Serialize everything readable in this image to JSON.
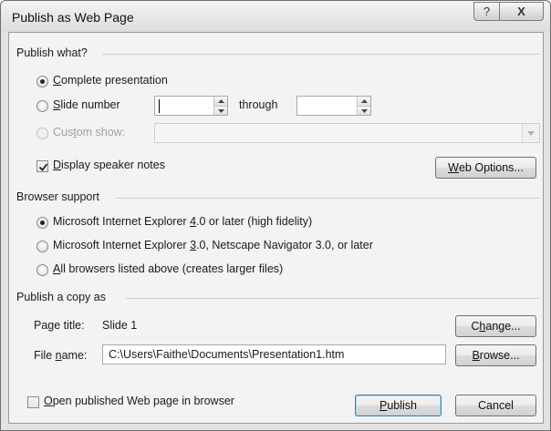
{
  "window": {
    "title": "Publish as Web Page",
    "help_label": "?",
    "close_label": "X"
  },
  "publish_what": {
    "heading": "Publish what?",
    "complete_presentation": {
      "pre": "",
      "mnemonic": "C",
      "post": "omplete presentation",
      "selected": true
    },
    "slide_number": {
      "pre": "",
      "mnemonic": "S",
      "post": "lide number",
      "selected": false,
      "from_value": "",
      "to_value": ""
    },
    "through": {
      "pre": "throu",
      "mnemonic": "g",
      "post": "h"
    },
    "custom_show": {
      "pre": "Cus",
      "mnemonic": "t",
      "post": "om show:",
      "selected": false,
      "enabled": false,
      "value": ""
    },
    "speaker_notes": {
      "pre": "",
      "mnemonic": "D",
      "post": "isplay speaker notes",
      "checked": true
    },
    "web_options": {
      "pre": "",
      "mnemonic": "W",
      "post": "eb Options..."
    }
  },
  "browser_support": {
    "heading": "Browser support",
    "ie4": {
      "pre": "Microsoft Internet Explorer ",
      "mnemonic": "4",
      "post": ".0 or later (high fidelity)",
      "selected": true
    },
    "ie3": {
      "pre": "Microsoft Internet Explorer ",
      "mnemonic": "3",
      "post": ".0, Netscape Navigator 3.0, or later",
      "selected": false
    },
    "all": {
      "pre": "",
      "mnemonic": "A",
      "post": "ll browsers listed above (creates larger files)",
      "selected": false
    }
  },
  "publish_copy": {
    "heading": "Publish a copy as",
    "page_title_label": "Page title:",
    "page_title_value": "Slide 1",
    "change": {
      "pre": "C",
      "mnemonic": "h",
      "post": "ange..."
    },
    "file_name": {
      "pre": "File ",
      "mnemonic": "n",
      "post": "ame:"
    },
    "file_name_value": "C:\\Users\\Faithe\\Documents\\Presentation1.htm",
    "browse": {
      "pre": "",
      "mnemonic": "B",
      "post": "rowse..."
    }
  },
  "footer": {
    "open_in_browser": {
      "pre": "",
      "mnemonic": "O",
      "post": "pen published Web page in browser",
      "checked": false
    },
    "publish": {
      "pre": "",
      "mnemonic": "P",
      "post": "ublish"
    },
    "cancel": "Cancel"
  }
}
